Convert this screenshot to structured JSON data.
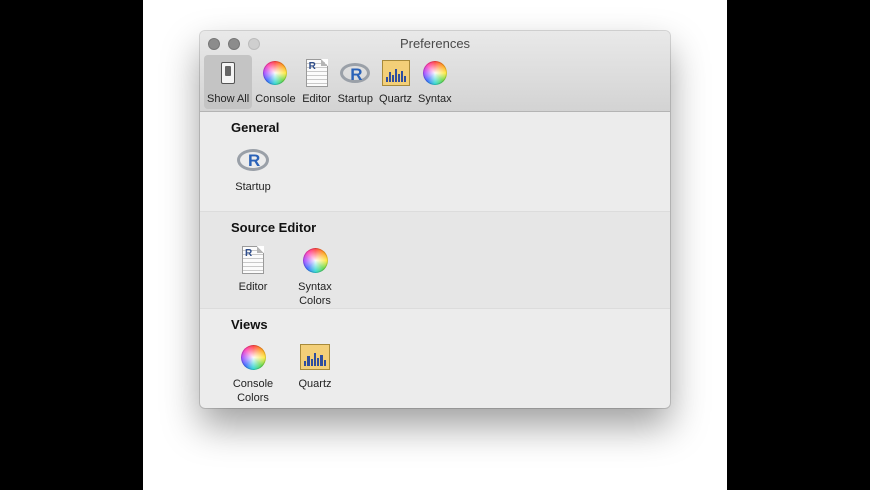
{
  "window": {
    "title": "Preferences"
  },
  "toolbar": {
    "items": [
      {
        "label": "Show All",
        "icon": "toggle-switch-icon",
        "active": true
      },
      {
        "label": "Console",
        "icon": "color-wheel-icon"
      },
      {
        "label": "Editor",
        "icon": "r-document-icon"
      },
      {
        "label": "Startup",
        "icon": "r-logo-icon"
      },
      {
        "label": "Quartz",
        "icon": "quartz-chart-icon"
      },
      {
        "label": "Syntax",
        "icon": "color-wheel-icon"
      }
    ]
  },
  "sections": [
    {
      "heading": "General",
      "items": [
        {
          "label": "Startup",
          "icon": "r-logo-icon"
        }
      ]
    },
    {
      "heading": "Source Editor",
      "items": [
        {
          "label": "Editor",
          "icon": "r-document-icon"
        },
        {
          "label": "Syntax\nColors",
          "icon": "color-wheel-icon"
        }
      ]
    },
    {
      "heading": "Views",
      "items": [
        {
          "label": "Console\nColors",
          "icon": "color-wheel-icon"
        },
        {
          "label": "Quartz",
          "icon": "quartz-chart-icon"
        }
      ]
    }
  ]
}
